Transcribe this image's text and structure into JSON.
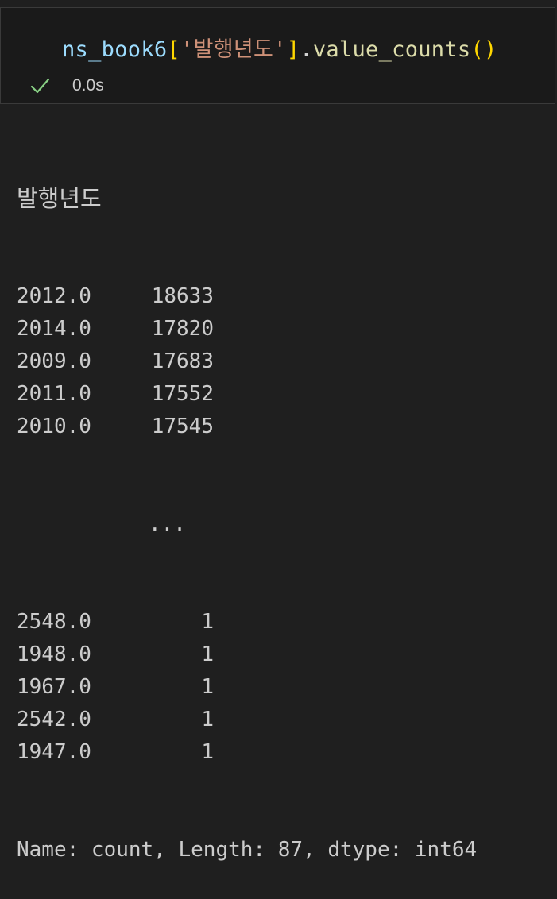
{
  "cell": {
    "code": {
      "var": "ns_book6",
      "bracket_open": "[",
      "string": "'발행년도'",
      "bracket_close": "]",
      "dot": ".",
      "func": "value_counts",
      "paren_open": "(",
      "paren_close": ")"
    },
    "status": {
      "icon": "checkmark-icon",
      "time": "0.0s",
      "success_color": "#89d185"
    }
  },
  "output": {
    "header": "발행년도",
    "rows_top": [
      {
        "index": "2012.0",
        "value": "18633"
      },
      {
        "index": "2014.0",
        "value": "17820"
      },
      {
        "index": "2009.0",
        "value": "17683"
      },
      {
        "index": "2011.0",
        "value": "17552"
      },
      {
        "index": "2010.0",
        "value": "17545"
      }
    ],
    "ellipsis": "...",
    "rows_bottom": [
      {
        "index": "2548.0",
        "value": "1"
      },
      {
        "index": "1948.0",
        "value": "1"
      },
      {
        "index": "1967.0",
        "value": "1"
      },
      {
        "index": "2542.0",
        "value": "1"
      },
      {
        "index": "1947.0",
        "value": "1"
      }
    ],
    "footer": "Name: count, Length: 87, dtype: int64"
  }
}
